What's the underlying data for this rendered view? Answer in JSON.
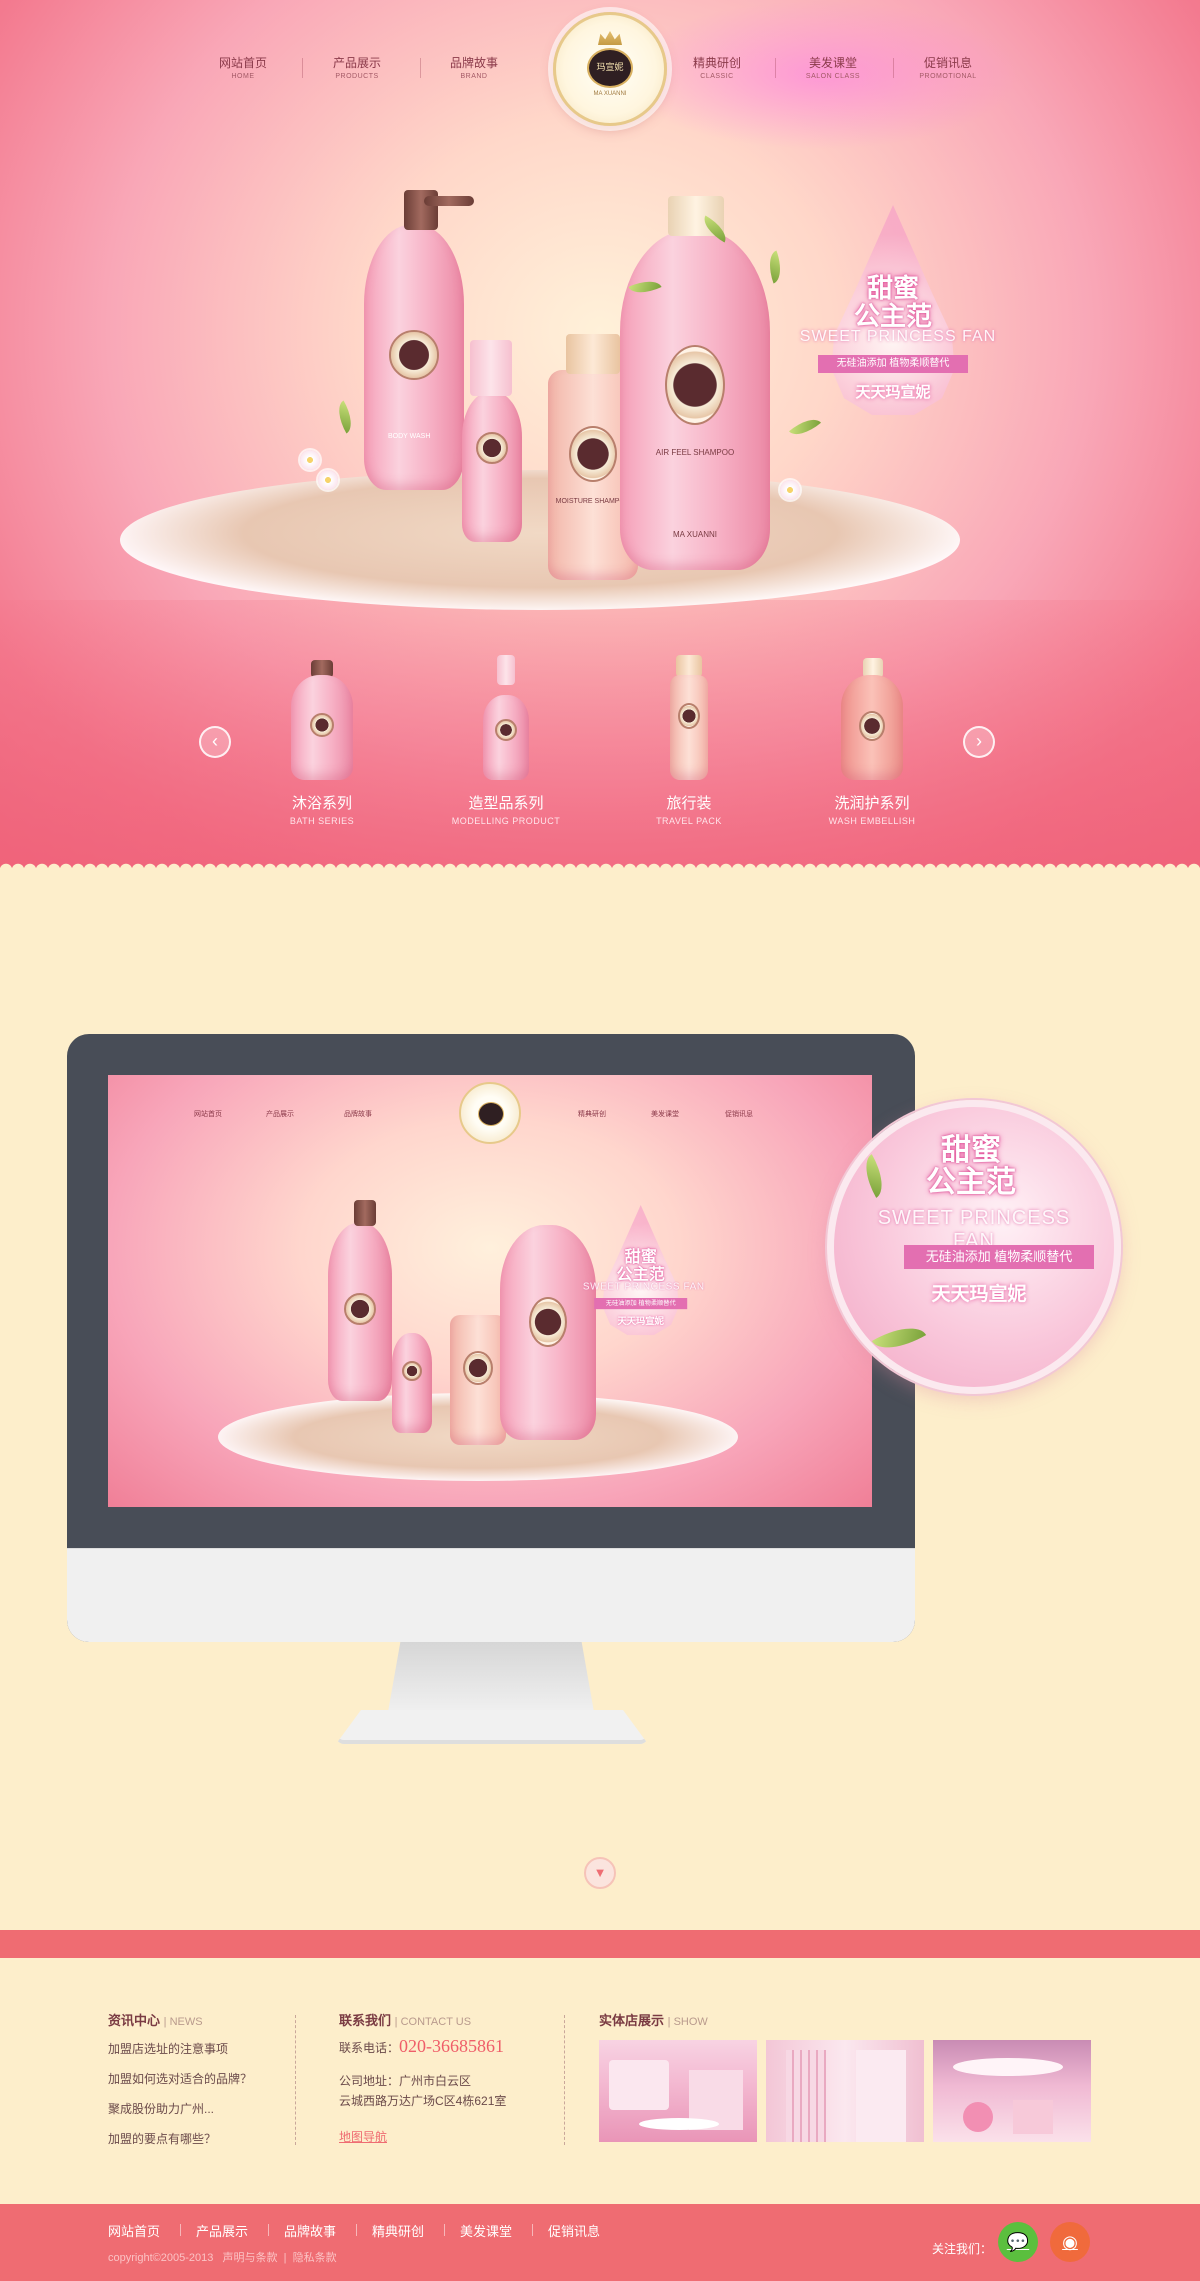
{
  "nav": {
    "items": [
      {
        "cn": "网站首页",
        "en": "HOME"
      },
      {
        "cn": "产品展示",
        "en": "PRODUCTS"
      },
      {
        "cn": "品牌故事",
        "en": "BRAND"
      },
      {
        "cn": "精典研创",
        "en": "CLASSIC"
      },
      {
        "cn": "美发课堂",
        "en": "SALON CLASS"
      },
      {
        "cn": "促销讯息",
        "en": "PROMOTIONAL"
      }
    ],
    "logo_text": "玛宣妮",
    "logo_sub": "MA XUANNI"
  },
  "hero": {
    "promo_title_1": "甜蜜",
    "promo_title_2": "公主范",
    "promo_en": "SWEET PRINCESS FAN",
    "promo_tag": "无硅油添加 植物柔顺替代",
    "promo_slogan": "天天玛宣妮",
    "bottle_labels": [
      "BODY WASH",
      "MOISTURE SHAMPOO",
      "AIR FEEL SHAMPOO",
      "MA XUANNI"
    ]
  },
  "carousel": {
    "prev_icon": "chevron-left-icon",
    "next_icon": "chevron-right-icon",
    "products": [
      {
        "cn": "沐浴系列",
        "en": "BATH SERIES"
      },
      {
        "cn": "造型品系列",
        "en": "MODELLING PRODUCT"
      },
      {
        "cn": "旅行装",
        "en": "TRAVEL PACK"
      },
      {
        "cn": "洗润护系列",
        "en": "WASH EMBELLISH"
      }
    ]
  },
  "showcase": {
    "screen_nav": [
      "网站首页",
      "产品展示",
      "品牌故事",
      "精典研创",
      "美发课堂",
      "促销讯息"
    ],
    "scroll_icon": "chevron-down-icon"
  },
  "footer": {
    "news": {
      "title": "资讯中心",
      "title_en": "NEWS",
      "items": [
        "加盟店选址的注意事项",
        "加盟如何选对适合的品牌？",
        "聚成股份助力广州...",
        "加盟的要点有哪些？"
      ]
    },
    "contact": {
      "title": "联系我们",
      "title_en": "CONTACT US",
      "phone_label": "联系电话：",
      "phone": "020-36685861",
      "address_line1": "公司地址：广州市白云区",
      "address_line2": "云城西路万达广场C区4栋621室",
      "map_link": "地图导航"
    },
    "show": {
      "title": "实体店展示",
      "title_en": "SHOW"
    },
    "nav": [
      "网站首页",
      "产品展示",
      "品牌故事",
      "精典研创",
      "美发课堂",
      "促销讯息"
    ],
    "copyright": "copyright©2005-2013",
    "legal_1": "声明与条款",
    "legal_2": "隐私条款",
    "follow_label": "关注我们：",
    "social": [
      {
        "icon": "wechat-icon",
        "color": "#5bbf3e"
      },
      {
        "icon": "weibo-icon",
        "color": "#f06a3c"
      }
    ]
  },
  "colors": {
    "accent": "#ef6c72",
    "background": "#fdeecb",
    "monitor": "#484d57"
  }
}
